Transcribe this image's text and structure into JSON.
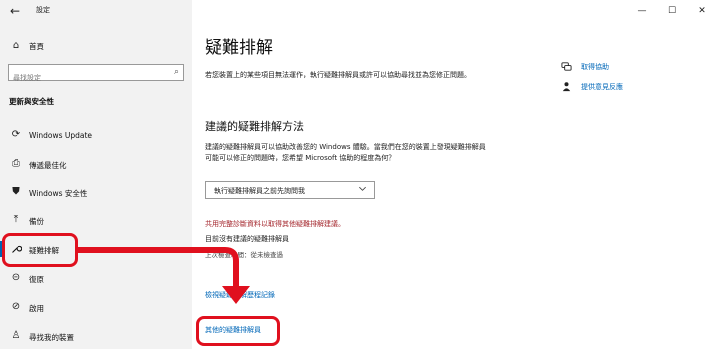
{
  "window": {
    "app_title": "設定",
    "back_glyph": "←",
    "minimize_glyph": "—",
    "maximize_glyph": "☐",
    "close_glyph": "✕"
  },
  "sidebar": {
    "home": {
      "label": "首頁",
      "icon": "home-icon",
      "glyph": "⌂"
    },
    "search": {
      "placeholder": "尋找設定",
      "icon": "search-icon",
      "glyph": "⌕"
    },
    "section_heading": "更新與安全性",
    "items": [
      {
        "label": "Windows Update",
        "icon": "sync-icon",
        "glyph": "⟳"
      },
      {
        "label": "傳遞最佳化",
        "icon": "delivery-icon",
        "glyph": "⎙"
      },
      {
        "label": "Windows 安全性",
        "icon": "shield-icon",
        "glyph": "⛊"
      },
      {
        "label": "備份",
        "icon": "backup-icon",
        "glyph": "⤒"
      },
      {
        "label": "疑難排解",
        "icon": "wrench-icon",
        "glyph": "🔧"
      },
      {
        "label": "復原",
        "icon": "recovery-icon",
        "glyph": "⊝"
      },
      {
        "label": "啟用",
        "icon": "activation-icon",
        "glyph": "⊘"
      },
      {
        "label": "尋找我的裝置",
        "icon": "find-device-icon",
        "glyph": "♙"
      }
    ],
    "selected_index": 4
  },
  "main": {
    "title": "疑難排解",
    "description": "若您裝置上的某些項目無法運作，執行疑難排解員或許可以協助尋找並為您修正問題。",
    "side_links": [
      {
        "label": "取得協助",
        "icon": "help-chat-icon",
        "glyph": "💬"
      },
      {
        "label": "提供意見反應",
        "icon": "feedback-icon",
        "glyph": "👤"
      }
    ],
    "recommended": {
      "heading": "建議的疑難排解方法",
      "description": "建議的疑難排解員可以協助改善您的 Windows 體驗。當我們在您的裝置上發現疑難排解員可能可以修正的問題時，您希望 Microsoft 協助的程度為何？",
      "dropdown_value": "執行疑難排解員之前先詢問我",
      "share_notice": "共用完整診斷資料以取得其他疑難排解建議。",
      "no_recommend": "目前沒有建議的疑難排解員",
      "last_check": "上次檢查時間：從未檢查過"
    },
    "history_link": "檢視疑難排解歷程記錄",
    "other_link": "其他的疑難排解員"
  },
  "colors": {
    "accent": "#0063b1",
    "link": "#0067b8",
    "warning": "#a4262c",
    "annotation": "#e0101e"
  }
}
